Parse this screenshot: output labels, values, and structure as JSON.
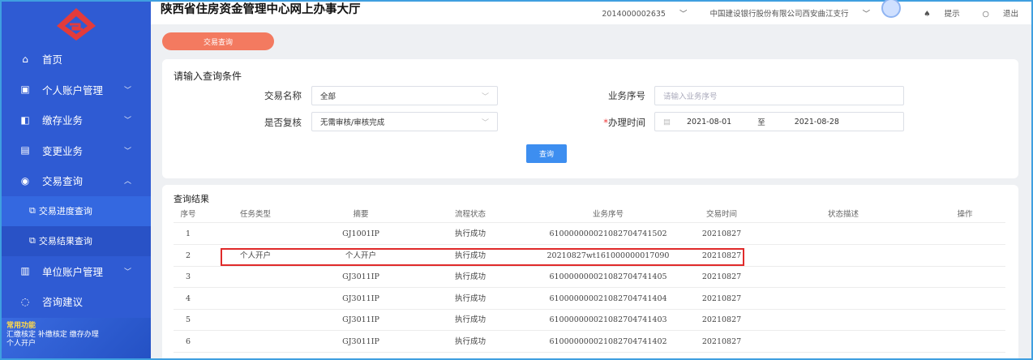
{
  "header": {
    "title": "陕西省住房资金管理中心网上办事大厅",
    "account": "2014000002635",
    "bank": "中国建设银行股份有限公司西安曲江支行",
    "tips": "提示",
    "logout": "退出"
  },
  "tab": {
    "label": "交易查询"
  },
  "sidebar": {
    "items": [
      {
        "label": "首页",
        "icon": "home-icon"
      },
      {
        "label": "个人账户管理",
        "icon": "wallet-icon",
        "chev": "﹀"
      },
      {
        "label": "缴存业务",
        "icon": "deposit-icon",
        "chev": "﹀"
      },
      {
        "label": "变更业务",
        "icon": "clipboard-icon",
        "chev": "﹀"
      },
      {
        "label": "交易查询",
        "icon": "search-icon",
        "chev": "︿"
      }
    ],
    "subitems": [
      {
        "label": "交易进度查询"
      },
      {
        "label": "交易结果查询"
      }
    ],
    "items2": [
      {
        "label": "单位账户管理",
        "icon": "building-icon",
        "chev": "﹀"
      },
      {
        "label": "咨询建议",
        "icon": "chat-icon"
      }
    ],
    "common": {
      "title": "常用功能",
      "line1": "汇缴核定  补缴核定  缴存办理",
      "line2": "个人开户"
    }
  },
  "query": {
    "title": "请输入查询条件",
    "trade_name_label": "交易名称",
    "trade_name_value": "全部",
    "review_label": "是否复核",
    "review_value": "无需审核/审核完成",
    "serial_label": "业务序号",
    "serial_placeholder": "请输入业务序号",
    "date_label": "办理时间",
    "date_required": "*",
    "date_from": "2021-08-01",
    "date_sep": "至",
    "date_to": "2021-08-28",
    "button": "查询"
  },
  "results": {
    "title": "查询结果",
    "columns": [
      "序号",
      "任务类型",
      "摘要",
      "流程状态",
      "业务序号",
      "交易时间",
      "状态描述",
      "操作"
    ],
    "rows": [
      [
        "1",
        "",
        "GJ1001IP",
        "执行成功",
        "6100000000210827047415 02",
        "20210827",
        "",
        ""
      ],
      [
        "2",
        "个人开户",
        "个人开户",
        "执行成功",
        "20210827wt161000000017090",
        "20210827",
        "",
        ""
      ],
      [
        "3",
        "",
        "GJ3011IP",
        "执行成功",
        "610000000021082704741405",
        "20210827",
        "",
        ""
      ],
      [
        "4",
        "",
        "GJ3011IP",
        "执行成功",
        "610000000021082704741404",
        "20210827",
        "",
        ""
      ],
      [
        "5",
        "",
        "GJ3011IP",
        "执行成功",
        "610000000021082704741403",
        "20210827",
        "",
        ""
      ],
      [
        "6",
        "",
        "GJ3011IP",
        "执行成功",
        "610000000021082704741402",
        "20210827",
        "",
        ""
      ]
    ]
  }
}
